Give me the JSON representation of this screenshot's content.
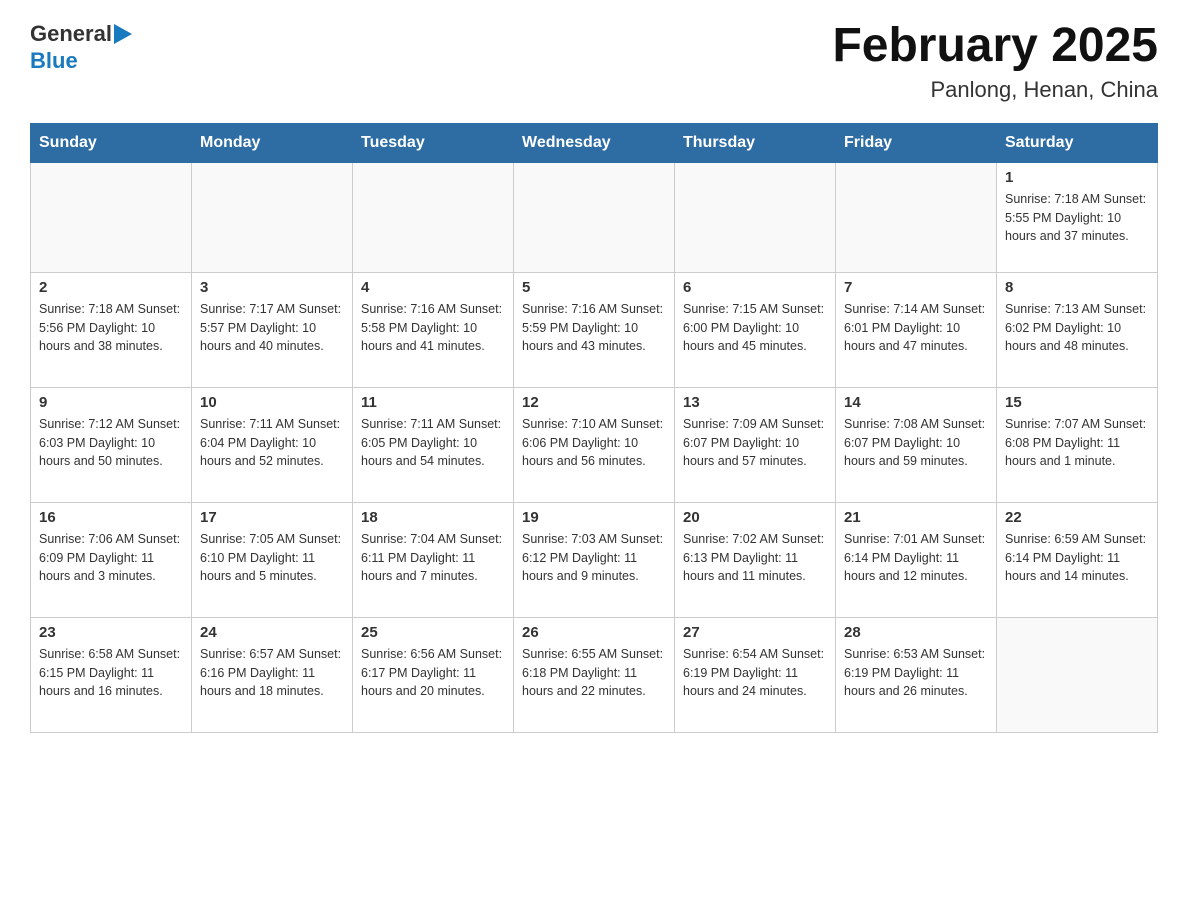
{
  "header": {
    "logo_general": "General",
    "logo_blue": "Blue",
    "title": "February 2025",
    "subtitle": "Panlong, Henan, China"
  },
  "days_of_week": [
    "Sunday",
    "Monday",
    "Tuesday",
    "Wednesday",
    "Thursday",
    "Friday",
    "Saturday"
  ],
  "weeks": [
    [
      {
        "day": "",
        "info": ""
      },
      {
        "day": "",
        "info": ""
      },
      {
        "day": "",
        "info": ""
      },
      {
        "day": "",
        "info": ""
      },
      {
        "day": "",
        "info": ""
      },
      {
        "day": "",
        "info": ""
      },
      {
        "day": "1",
        "info": "Sunrise: 7:18 AM\nSunset: 5:55 PM\nDaylight: 10 hours and 37 minutes."
      }
    ],
    [
      {
        "day": "2",
        "info": "Sunrise: 7:18 AM\nSunset: 5:56 PM\nDaylight: 10 hours and 38 minutes."
      },
      {
        "day": "3",
        "info": "Sunrise: 7:17 AM\nSunset: 5:57 PM\nDaylight: 10 hours and 40 minutes."
      },
      {
        "day": "4",
        "info": "Sunrise: 7:16 AM\nSunset: 5:58 PM\nDaylight: 10 hours and 41 minutes."
      },
      {
        "day": "5",
        "info": "Sunrise: 7:16 AM\nSunset: 5:59 PM\nDaylight: 10 hours and 43 minutes."
      },
      {
        "day": "6",
        "info": "Sunrise: 7:15 AM\nSunset: 6:00 PM\nDaylight: 10 hours and 45 minutes."
      },
      {
        "day": "7",
        "info": "Sunrise: 7:14 AM\nSunset: 6:01 PM\nDaylight: 10 hours and 47 minutes."
      },
      {
        "day": "8",
        "info": "Sunrise: 7:13 AM\nSunset: 6:02 PM\nDaylight: 10 hours and 48 minutes."
      }
    ],
    [
      {
        "day": "9",
        "info": "Sunrise: 7:12 AM\nSunset: 6:03 PM\nDaylight: 10 hours and 50 minutes."
      },
      {
        "day": "10",
        "info": "Sunrise: 7:11 AM\nSunset: 6:04 PM\nDaylight: 10 hours and 52 minutes."
      },
      {
        "day": "11",
        "info": "Sunrise: 7:11 AM\nSunset: 6:05 PM\nDaylight: 10 hours and 54 minutes."
      },
      {
        "day": "12",
        "info": "Sunrise: 7:10 AM\nSunset: 6:06 PM\nDaylight: 10 hours and 56 minutes."
      },
      {
        "day": "13",
        "info": "Sunrise: 7:09 AM\nSunset: 6:07 PM\nDaylight: 10 hours and 57 minutes."
      },
      {
        "day": "14",
        "info": "Sunrise: 7:08 AM\nSunset: 6:07 PM\nDaylight: 10 hours and 59 minutes."
      },
      {
        "day": "15",
        "info": "Sunrise: 7:07 AM\nSunset: 6:08 PM\nDaylight: 11 hours and 1 minute."
      }
    ],
    [
      {
        "day": "16",
        "info": "Sunrise: 7:06 AM\nSunset: 6:09 PM\nDaylight: 11 hours and 3 minutes."
      },
      {
        "day": "17",
        "info": "Sunrise: 7:05 AM\nSunset: 6:10 PM\nDaylight: 11 hours and 5 minutes."
      },
      {
        "day": "18",
        "info": "Sunrise: 7:04 AM\nSunset: 6:11 PM\nDaylight: 11 hours and 7 minutes."
      },
      {
        "day": "19",
        "info": "Sunrise: 7:03 AM\nSunset: 6:12 PM\nDaylight: 11 hours and 9 minutes."
      },
      {
        "day": "20",
        "info": "Sunrise: 7:02 AM\nSunset: 6:13 PM\nDaylight: 11 hours and 11 minutes."
      },
      {
        "day": "21",
        "info": "Sunrise: 7:01 AM\nSunset: 6:14 PM\nDaylight: 11 hours and 12 minutes."
      },
      {
        "day": "22",
        "info": "Sunrise: 6:59 AM\nSunset: 6:14 PM\nDaylight: 11 hours and 14 minutes."
      }
    ],
    [
      {
        "day": "23",
        "info": "Sunrise: 6:58 AM\nSunset: 6:15 PM\nDaylight: 11 hours and 16 minutes."
      },
      {
        "day": "24",
        "info": "Sunrise: 6:57 AM\nSunset: 6:16 PM\nDaylight: 11 hours and 18 minutes."
      },
      {
        "day": "25",
        "info": "Sunrise: 6:56 AM\nSunset: 6:17 PM\nDaylight: 11 hours and 20 minutes."
      },
      {
        "day": "26",
        "info": "Sunrise: 6:55 AM\nSunset: 6:18 PM\nDaylight: 11 hours and 22 minutes."
      },
      {
        "day": "27",
        "info": "Sunrise: 6:54 AM\nSunset: 6:19 PM\nDaylight: 11 hours and 24 minutes."
      },
      {
        "day": "28",
        "info": "Sunrise: 6:53 AM\nSunset: 6:19 PM\nDaylight: 11 hours and 26 minutes."
      },
      {
        "day": "",
        "info": ""
      }
    ]
  ]
}
